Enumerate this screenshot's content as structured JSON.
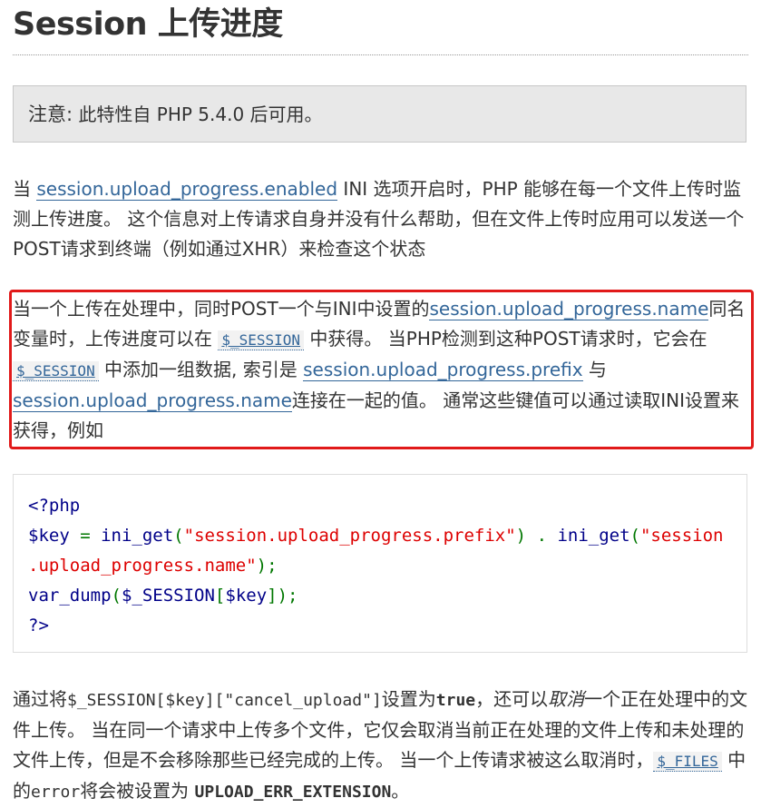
{
  "title": "Session 上传进度",
  "note": {
    "label": "注意:",
    "text": " 此特性自 PHP 5.4.0 后可用。"
  },
  "para1": {
    "t1": "当 ",
    "link": "session.upload_progress.enabled",
    "t2": " INI 选项开启时，PHP 能够在每一个文件上传时监测上传进度。 这个信息对上传请求自身并没有什么帮助，但在文件上传时应用可以发送一个POST请求到终端（例如通过XHR）来检查这个状态"
  },
  "para2": {
    "t1": "当一个上传在处理中，同时POST一个与INI中设置的",
    "link1": "session.upload_progress.name",
    "t2": "同名变量时，上传进度可以在 ",
    "var1": "$_SESSION",
    "t3": " 中获得。 当PHP检测到这种POST请求时，它会在 ",
    "var2": "$_SESSION",
    "t4": " 中添加一组数据, 索引是 ",
    "link2": "session.upload_progress.prefix",
    "t5": " 与 ",
    "link3": "session.upload_progress.name",
    "t6": "连接在一起的值。 通常这些键值可以通过读取INI设置来获得，例如"
  },
  "code": {
    "open_tag": "<?php",
    "line2_var": "$key",
    "line2_eq": " = ",
    "line2_fn1": "ini_get",
    "line2_p1": "(",
    "line2_str1": "\"session.upload_progress.prefix\"",
    "line2_p2": ")",
    "line2_dot": " . ",
    "line2_fn2": "ini_get",
    "line2_p3": "(",
    "line2_str2a": "\"session",
    "line3_str2b": ".upload_progress.name\"",
    "line3_p4": ");",
    "line4_fn": "var_dump",
    "line4_p1": "(",
    "line4_var1": "$_SESSION",
    "line4_p2": "[",
    "line4_var2": "$key",
    "line4_p3": "]);",
    "close_tag": "?>"
  },
  "para3": {
    "t1": "通过将",
    "code1": "$_SESSION[$key][\"cancel_upload\"]",
    "t2": "设置为",
    "bold1": "true",
    "t3": "，还可以",
    "em1": "取消",
    "t4": "一个正在处理中的文件上传。 当在同一个请求中上传多个文件，它仅会取消当前正在处理的文件上传和未处理的文件上传，但是不会移除那些已经完成的上传。 当一个上传请求被这么取消时，",
    "var1": "$_FILES",
    "t5": " 中的",
    "code2": "error",
    "t6": "将会被设置为 ",
    "bold2": "UPLOAD_ERR_EXTENSION",
    "t7": "。"
  }
}
